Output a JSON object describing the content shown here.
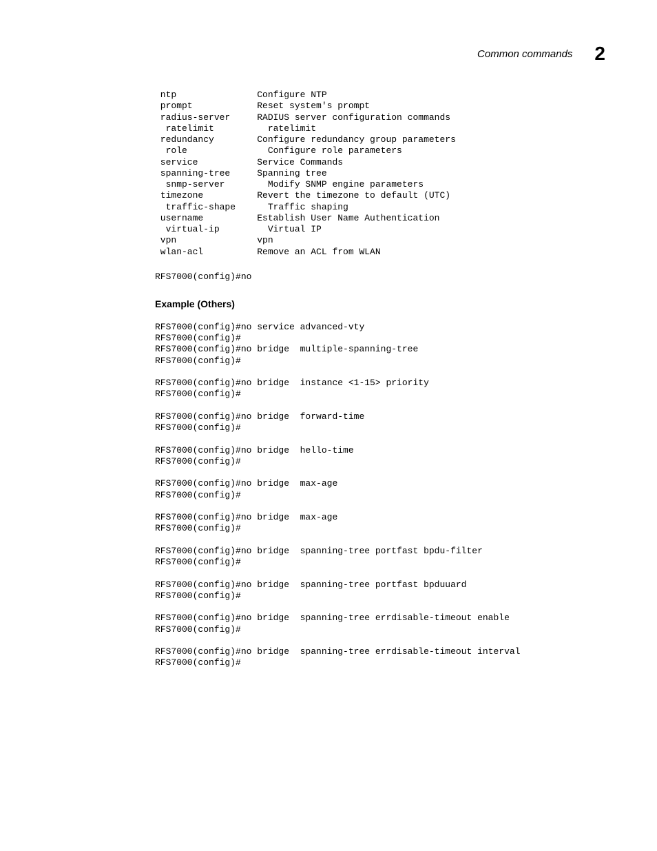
{
  "header": {
    "title": "Common commands",
    "chapter_number": "2"
  },
  "command_table": {
    "rows": [
      {
        "cmd": " ntp",
        "desc": "Configure NTP"
      },
      {
        "cmd": " prompt",
        "desc": "Reset system's prompt"
      },
      {
        "cmd": " radius-server",
        "desc": "RADIUS server configuration commands"
      },
      {
        "cmd": "  ratelimit",
        "desc": "  ratelimit"
      },
      {
        "cmd": " redundancy",
        "desc": "Configure redundancy group parameters"
      },
      {
        "cmd": "  role",
        "desc": "  Configure role parameters"
      },
      {
        "cmd": " service",
        "desc": "Service Commands"
      },
      {
        "cmd": " spanning-tree",
        "desc": "Spanning tree"
      },
      {
        "cmd": "  snmp-server",
        "desc": "  Modify SNMP engine parameters"
      },
      {
        "cmd": " timezone",
        "desc": "Revert the timezone to default (UTC)"
      },
      {
        "cmd": "  traffic-shape",
        "desc": "  Traffic shaping"
      },
      {
        "cmd": " username",
        "desc": "Establish User Name Authentication"
      },
      {
        "cmd": "  virtual-ip",
        "desc": "  Virtual IP"
      },
      {
        "cmd": " vpn",
        "desc": "vpn"
      },
      {
        "cmd": " wlan-acl",
        "desc": "Remove an ACL from WLAN"
      }
    ]
  },
  "prompt_after_table": "RFS7000(config)#no",
  "section_heading": "Example (Others)",
  "examples": [
    "RFS7000(config)#no service advanced-vty",
    "RFS7000(config)#",
    "RFS7000(config)#no bridge  multiple-spanning-tree",
    "RFS7000(config)#",
    "",
    "RFS7000(config)#no bridge  instance <1-15> priority",
    "RFS7000(config)#",
    "",
    "RFS7000(config)#no bridge  forward-time",
    "RFS7000(config)#",
    "",
    "RFS7000(config)#no bridge  hello-time",
    "RFS7000(config)#",
    "",
    "RFS7000(config)#no bridge  max-age",
    "RFS7000(config)#",
    "",
    "RFS7000(config)#no bridge  max-age",
    "RFS7000(config)#",
    "",
    "RFS7000(config)#no bridge  spanning-tree portfast bpdu-filter",
    "RFS7000(config)#",
    "",
    "RFS7000(config)#no bridge  spanning-tree portfast bpduuard",
    "RFS7000(config)#",
    "",
    "RFS7000(config)#no bridge  spanning-tree errdisable-timeout enable",
    "RFS7000(config)#",
    "",
    "RFS7000(config)#no bridge  spanning-tree errdisable-timeout interval",
    "RFS7000(config)#"
  ]
}
